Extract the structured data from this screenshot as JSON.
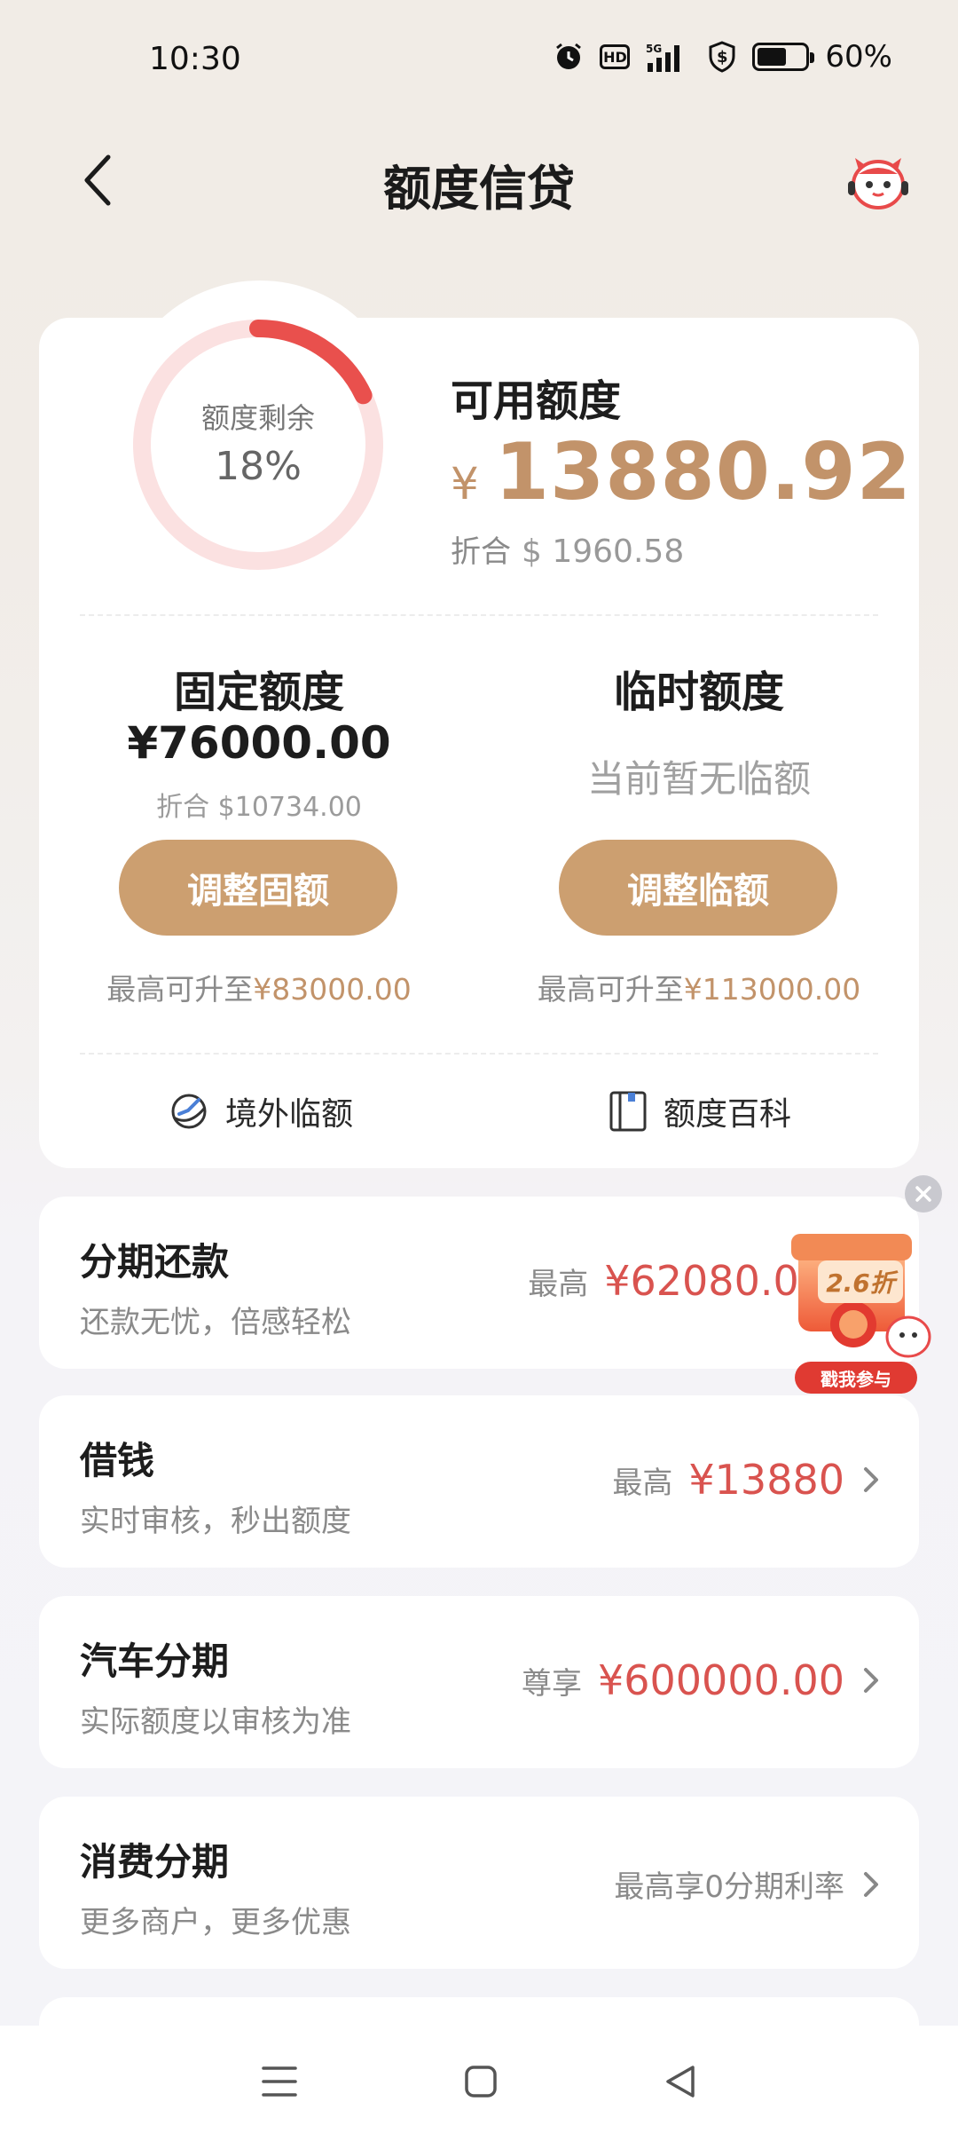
{
  "status_bar": {
    "time": "10:30",
    "network": "5G",
    "battery_pct": "60%",
    "battery_level": 0.6,
    "icons": [
      "alarm-icon",
      "hd-icon",
      "signal-5g-icon",
      "shield-dollar-icon",
      "battery-icon"
    ]
  },
  "header": {
    "title": "额度信贷",
    "back_icon": "chevron-left-icon",
    "assistant_icon": "mascot-avatar-icon"
  },
  "summary": {
    "ring_label": "额度剩余",
    "ring_percent": "18%",
    "ring_fraction": 0.18,
    "available_title": "可用额度",
    "currency_symbol": "¥",
    "available_amount": "13880.92",
    "converted_label": "折合",
    "converted_amount": "$ 1960.58"
  },
  "fixed_limit": {
    "title": "固定额度",
    "amount": "¥76000.00",
    "converted": "折合 $10734.00",
    "button": "调整固额",
    "max_prefix": "最高可升至",
    "max_value": "¥83000.00"
  },
  "temp_limit": {
    "title": "临时额度",
    "status": "当前暂无临额",
    "button": "调整临额",
    "max_prefix": "最高可升至",
    "max_value": "¥113000.00"
  },
  "footer_links": [
    {
      "label": "境外临额",
      "icon": "globe-plane-icon"
    },
    {
      "label": "额度百科",
      "icon": "book-icon"
    }
  ],
  "products": [
    {
      "title": "分期还款",
      "subtitle": "还款无忧，倍感轻松",
      "prefix": "最高",
      "value": "¥62080.00"
    },
    {
      "title": "借钱",
      "subtitle": "实时审核，秒出额度",
      "prefix": "最高",
      "value": "¥13880"
    },
    {
      "title": "汽车分期",
      "subtitle": "实际额度以审核为准",
      "prefix": "尊享",
      "value": "¥600000.00"
    },
    {
      "title": "消费分期",
      "subtitle": "更多商户，更多优惠",
      "plain": "最高享0分期利率"
    }
  ],
  "promo": {
    "discount": "2.6折",
    "cta": "戳我参与"
  },
  "colors": {
    "accent_gold": "#c2936a",
    "button_gold": "#cc9f70",
    "value_red": "#d9534f",
    "ring_red": "#e9504d",
    "ring_track": "#fbe1e1"
  },
  "nav": [
    "menu-icon",
    "home-square-icon",
    "back-triangle-icon"
  ]
}
